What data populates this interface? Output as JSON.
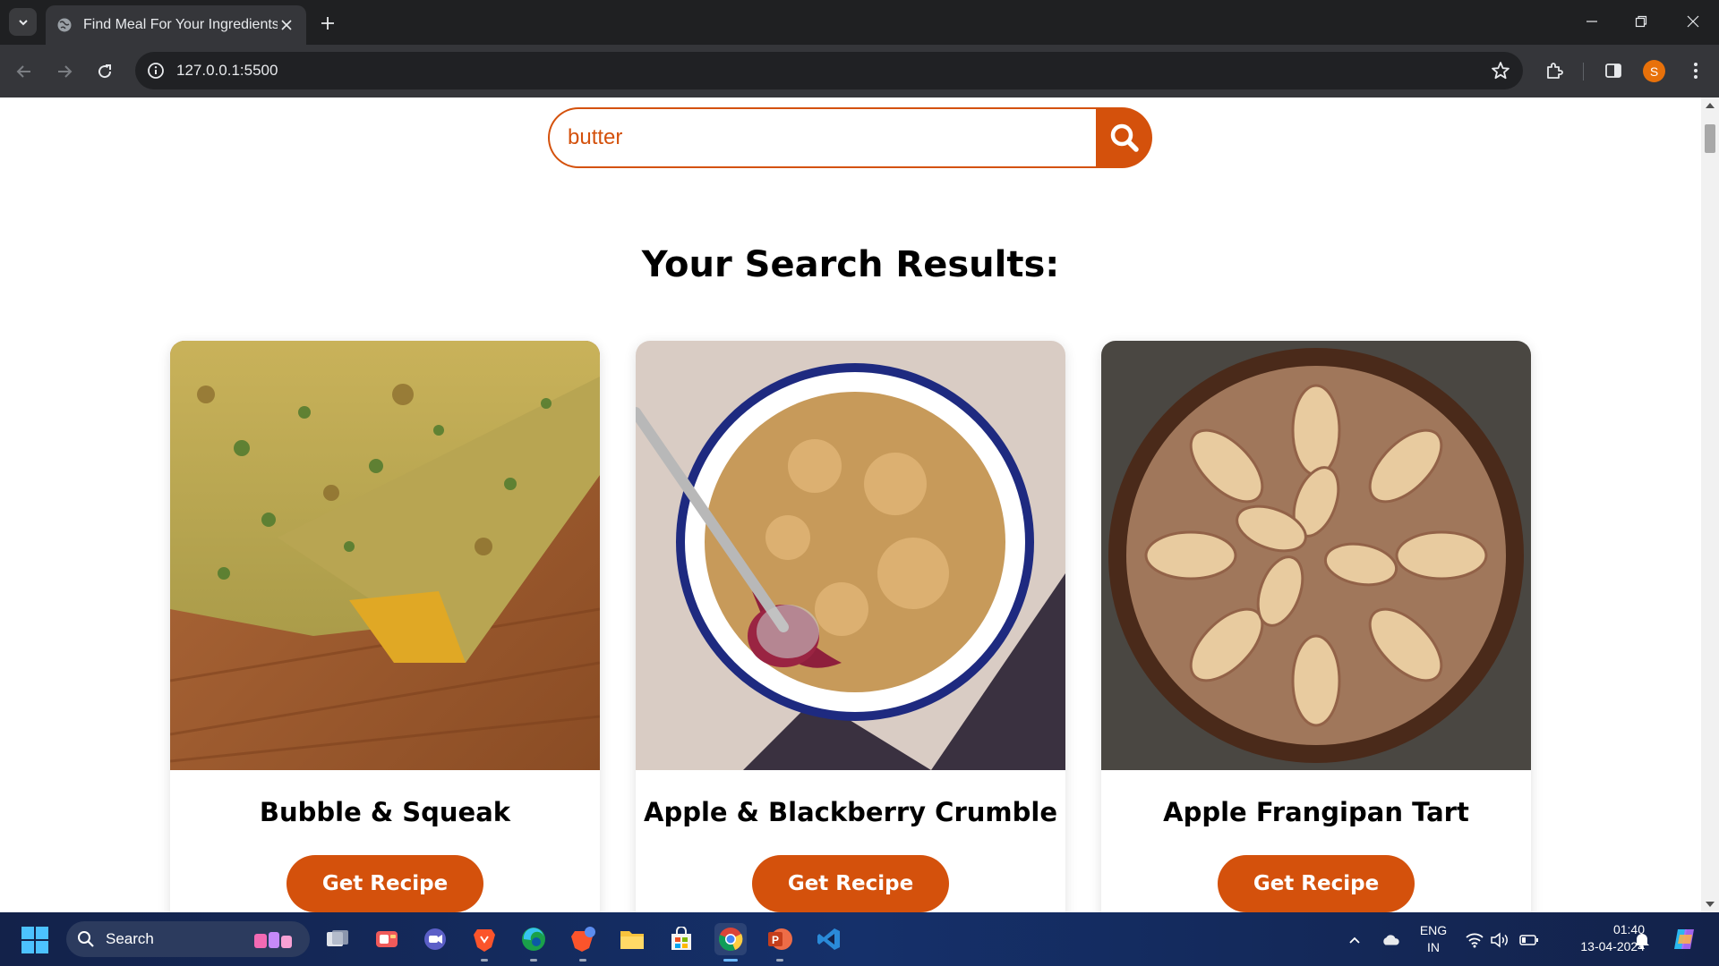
{
  "browser": {
    "tab_title": "Find Meal For Your Ingredients",
    "url": "127.0.0.1:5500",
    "profile_initial": "S"
  },
  "page": {
    "search_value": "butter",
    "results_heading": "Your Search Results:",
    "accent_color": "#d4510c",
    "meals": [
      {
        "name": "Bubble & Squeak",
        "button": "Get Recipe"
      },
      {
        "name": "Apple & Blackberry Crumble",
        "button": "Get Recipe"
      },
      {
        "name": "Apple Frangipan Tart",
        "button": "Get Recipe"
      }
    ]
  },
  "taskbar": {
    "search_label": "Search",
    "apps": [
      "task-view-icon",
      "teams-icon",
      "meet-icon",
      "brave-icon",
      "edge-icon",
      "brave-beta-icon",
      "file-explorer-icon",
      "microsoft-store-icon",
      "chrome-icon",
      "powerpoint-icon",
      "vscode-icon"
    ],
    "language_top": "ENG",
    "language_bottom": "IN",
    "time": "01:40",
    "date": "13-04-2024"
  }
}
